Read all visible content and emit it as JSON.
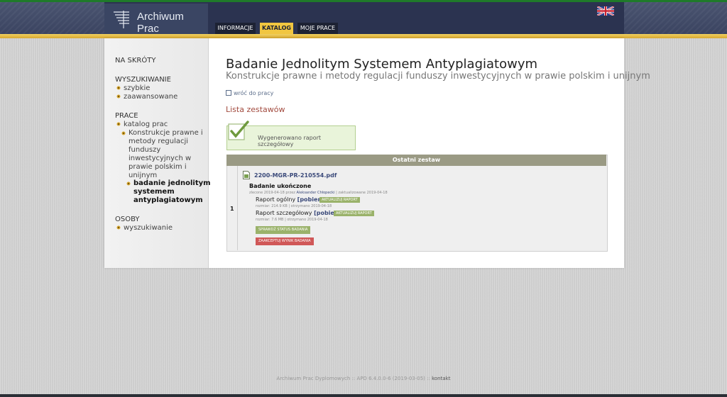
{
  "header": {
    "app_name": "Archiwum Prac",
    "tabs": [
      {
        "label": "INFORMACJE",
        "active": false
      },
      {
        "label": "KATALOG",
        "active": true
      },
      {
        "label": "MOJE PRACE",
        "active": false
      }
    ],
    "language_icon": "uk-flag-icon"
  },
  "sidebar": {
    "shortcuts": "NA SKRÓTY",
    "search_heading": "WYSZUKIWANIE",
    "search_items": [
      "szybkie",
      "zaawansowane"
    ],
    "works_heading": "PRACE",
    "works_items": [
      "katalog prac"
    ],
    "works_sub_lines": [
      "Konstrukcje prawne i",
      "metody regulacji",
      "funduszy",
      "inwestycyjnych w",
      "prawie polskim i",
      "unijnym"
    ],
    "works_current_lines": [
      "badanie jednolitym",
      "systemem",
      "antyplagiatowym"
    ],
    "people_heading": "OSOBY",
    "people_items": [
      "wyszukiwanie"
    ]
  },
  "main": {
    "title": "Badanie Jednolitym Systemem Antyplagiatowym",
    "subtitle": "Konstrukcje prawne i metody regulacji funduszy inwestycyjnych w prawie polskim i unijnym",
    "back_link": "wróć do pracy",
    "section_title": "Lista zestawów",
    "success_message": "Wygenerowano raport szczegółowy",
    "panel": {
      "header": "Ostatni zestaw",
      "row_number": "1",
      "file_name": "2200-MGR-PR-210554.pdf",
      "status": "Badanie ukończone",
      "meta_ordered": "zlecone 2019-04-18 przez",
      "meta_person": "Aleksander Chłopecki",
      "meta_updated": "| zaktualizowane 2019-04-18",
      "report_general_label": "Raport ogólny",
      "report_general_download": "[pobierz]",
      "report_general_update": "AKTUALIZUJ RAPORT",
      "report_general_meta": "rozmiar: 214.9 KB | otrzymano 2019-04-18",
      "report_detailed_label": "Raport szczegółowy",
      "report_detailed_download": "[pobierz]",
      "report_detailed_update": "AKTUALIZUJ RAPORT",
      "report_detailed_meta": "rozmiar: 7.6 MB | otrzymano 2019-04-18",
      "check_status_button": "SPRAWDŹ STATUS BADANIA",
      "accept_button": "ZAAKCEPTUJ WYNIK BADANIA"
    }
  },
  "footer": {
    "text": "Archiwum Prac Dyplomowych :: APD 6.4.0.0-6 (2019-03-05) ::",
    "contact": "kontakt"
  },
  "colors": {
    "accent_gold": "#f1c640",
    "header_dark": "#2b3350",
    "section_title": "#a24a3e",
    "success_bg": "#e9f4da",
    "button_green": "#9ab26a",
    "button_red": "#d05858"
  }
}
